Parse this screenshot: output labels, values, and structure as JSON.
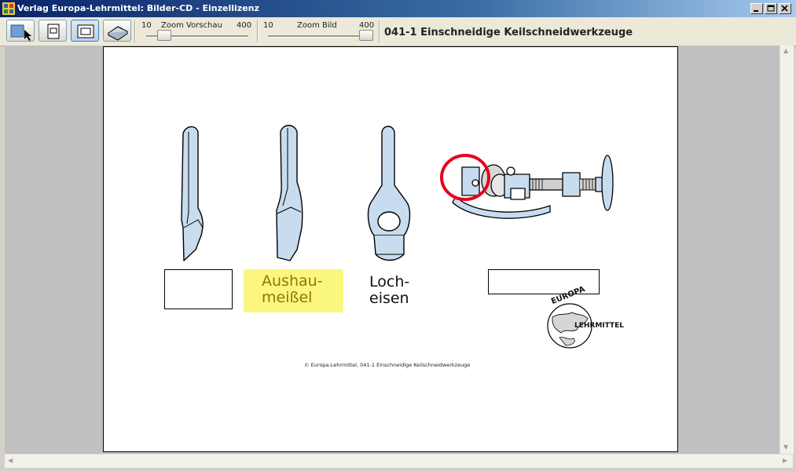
{
  "window": {
    "title": "Verlag Europa-Lehrmittel: Bilder-CD - Einzellizenz",
    "icon": "app-icon"
  },
  "toolbar": {
    "zoom_preview": {
      "label": "Zoom Vorschau",
      "min": "10",
      "max": "400",
      "value_fraction": 0.08
    },
    "zoom_image": {
      "label": "Zoom Bild",
      "min": "10",
      "max": "400",
      "value_fraction": 1.0
    },
    "document_title": "041-1 Einschneidige Keilschneidwerkzeuge"
  },
  "figure": {
    "labels": {
      "tool_1": "",
      "tool_2": "Aushau-\nmeißel",
      "tool_3": "Loch-\neisen",
      "tool_4": ""
    },
    "caption": "© Europa-Lehrmittel, 041-1 Einschneidige Keilschneidwerkzeuge",
    "logo": {
      "top": "EUROPA",
      "right": "LEHRMITTEL"
    },
    "colors": {
      "tool_fill": "#c7dcef",
      "highlight": "#fbf680",
      "circle_mark": "#e8001c",
      "label_text": "#8a7a00"
    }
  }
}
